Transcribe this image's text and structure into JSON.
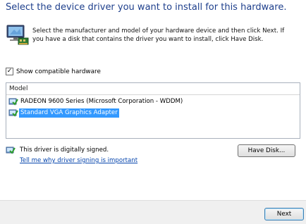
{
  "header": {
    "title": "Select the device driver you want to install for this hardware."
  },
  "intro": {
    "text": "Select the manufacturer and model of your hardware device and then click Next. If you have a disk that contains the driver you want to install, click Have Disk."
  },
  "options": {
    "show_compatible_label": "Show compatible hardware",
    "show_compatible_checked": true
  },
  "model_list": {
    "header": "Model",
    "items": [
      {
        "label": "RADEON 9600 Series (Microsoft Corporation - WDDM)",
        "selected": false
      },
      {
        "label": "Standard VGA Graphics Adapter",
        "selected": true
      }
    ]
  },
  "signing": {
    "status_text": "This driver is digitally signed.",
    "link_text": "Tell me why driver signing is important"
  },
  "buttons": {
    "have_disk": "Have Disk...",
    "next": "Next"
  },
  "colors": {
    "heading": "#1e3f8c",
    "selection": "#3399ff",
    "link": "#0645ad"
  }
}
